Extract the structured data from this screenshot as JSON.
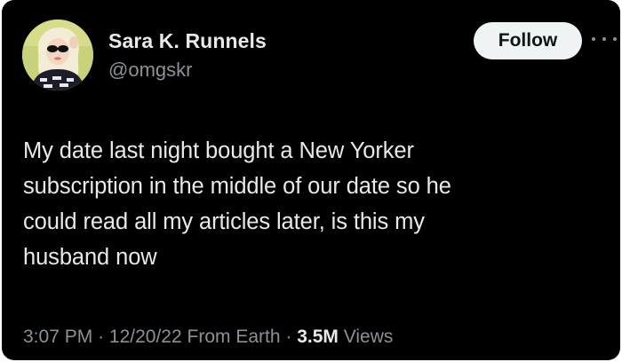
{
  "author": {
    "name": "Sara K. Runnels",
    "handle": "@omgskr"
  },
  "follow_button": {
    "label": "Follow"
  },
  "more_icon": "more-horizontal-icon",
  "tweet": {
    "text": "My date last night bought a New Yorker\nsubscription in the middle of our date so he\ncould read all my articles later, is this my\nhusband now"
  },
  "meta": {
    "time": "3:07 PM",
    "separator": "·",
    "date": "12/20/22",
    "source": "From Earth",
    "views_count": "3.5M",
    "views_label": "Views"
  },
  "colors": {
    "background": "#000000",
    "primary_text": "#e7e9ea",
    "secondary_text": "#8b9196",
    "button_bg": "#eff3f4",
    "button_text": "#0f1419"
  }
}
